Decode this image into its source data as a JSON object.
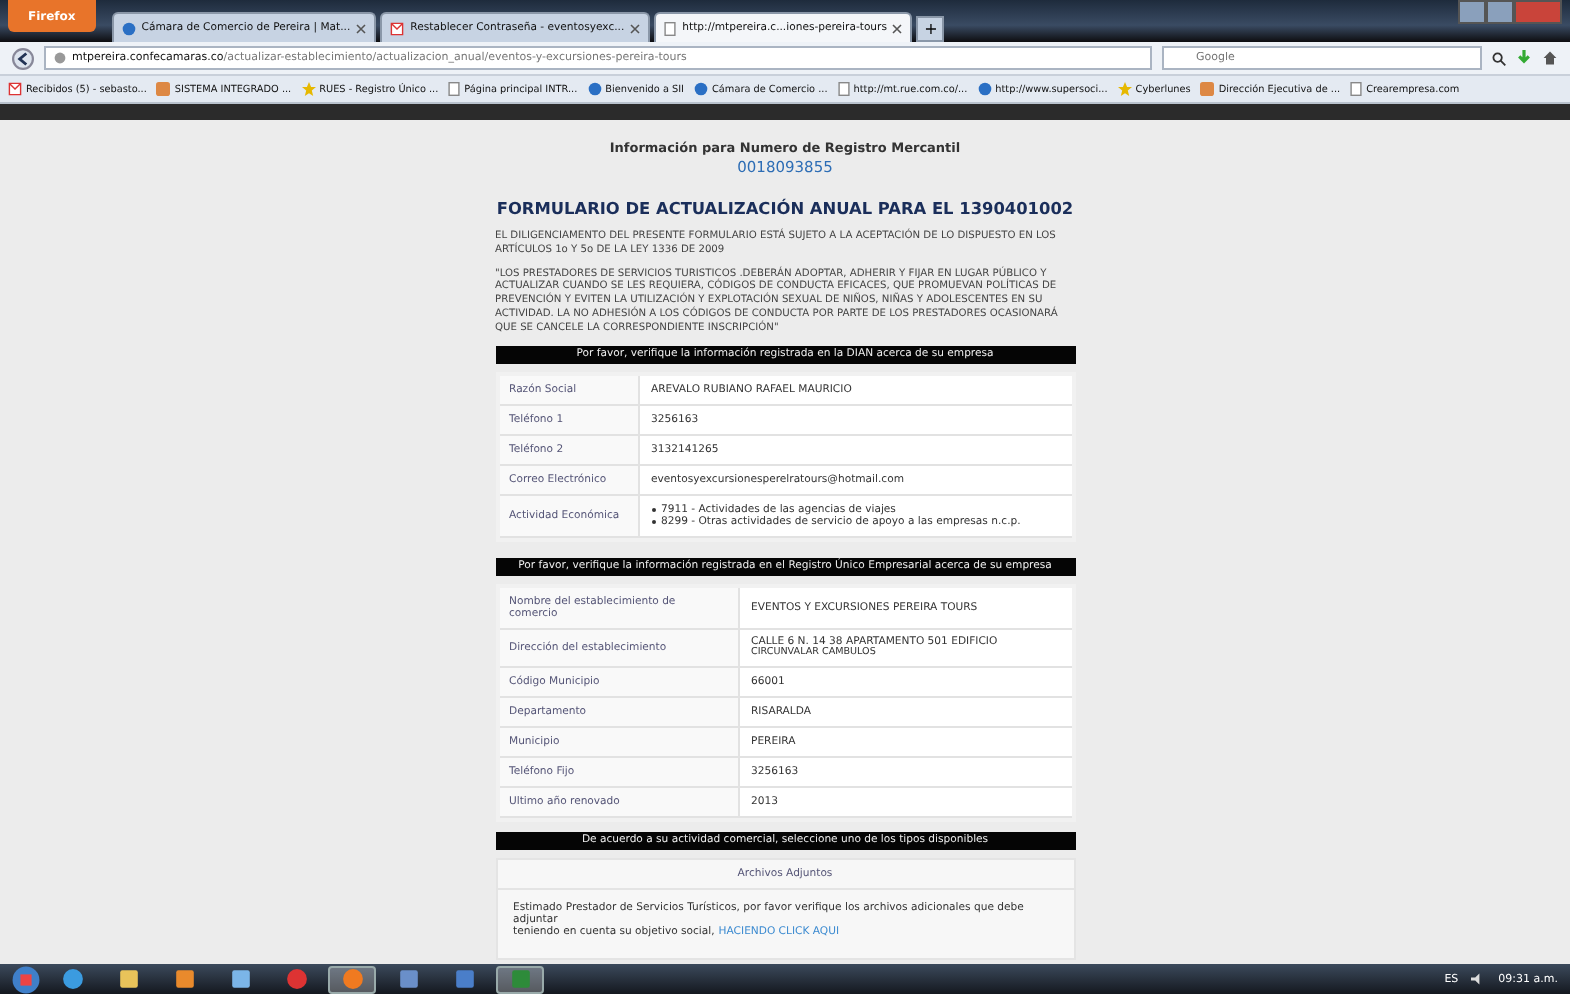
{
  "browser": {
    "menu_button": "Firefox",
    "tabs": [
      {
        "label": "Cámara de Comercio de Pereira | Mat...",
        "selected": false
      },
      {
        "label": "Restablecer Contraseña - eventosyexc...",
        "selected": false
      },
      {
        "label": "http://mtpereira.c...iones-pereira-tours",
        "selected": true
      }
    ],
    "new_tab": "+",
    "address": {
      "domain": "mtpereira.confecamaras.co",
      "path": "/actualizar-establecimiento/actualizacion_anual/eventos-y-excursiones-pereira-tours"
    },
    "search": {
      "placeholder": "Google"
    },
    "bookmarks": [
      "Recibidos (5) - sebasto...",
      "SISTEMA INTEGRADO ...",
      "RUES - Registro Único ...",
      "Página principal INTR...",
      "Bienvenido a SII",
      "Cámara de Comercio ...",
      "http://mt.rue.com.co/...",
      "http://www.supersoci...",
      "Cyberlunes",
      "Dirección Ejecutiva de ...",
      "Crearempresa.com"
    ]
  },
  "page": {
    "header": "Información para Numero de Registro Mercantil",
    "registry_number": "0018093855",
    "title": "FORMULARIO DE ACTUALIZACIÓN ANUAL PARA EL 1390401002",
    "notice": "EL DILIGENCIAMENTO DEL PRESENTE FORMULARIO ESTÁ SUJETO A LA ACEPTACIÓN DE LO DISPUESTO EN LOS ARTÍCULOS 1o Y 5o DE LA LEY 1336 DE 2009",
    "quote": "\"LOS PRESTADORES DE SERVICIOS TURISTICOS .DEBERÁN ADOPTAR, ADHERIR Y FIJAR EN LUGAR PÚBLICO Y ACTUALIZAR CUANDO SE LES REQUIERA, CÓDIGOS DE CONDUCTA EFICACES, QUE PROMUEVAN POLÍTICAS DE PREVENCIÓN Y EVITEN LA UTILIZACIÓN Y EXPLOTACIÓN SEXUAL DE NIÑOS, NIÑAS Y ADOLESCENTES EN SU ACTIVIDAD. LA NO ADHESIÓN A LOS CÓDIGOS DE CONDUCTA POR PARTE DE LOS PRESTADORES OCASIONARÁ QUE SE CANCELE LA CORRESPONDIENTE INSCRIPCIÓN\"",
    "dian_bar": "Por favor, verifique la información registrada en la DIAN acerca de su empresa",
    "dian_rows": [
      {
        "label": "Razón Social",
        "value": "AREVALO RUBIANO RAFAEL MAURICIO"
      },
      {
        "label": "Teléfono 1",
        "value": "3256163"
      },
      {
        "label": "Teléfono 2",
        "value": "3132141265"
      },
      {
        "label": "Correo Electrónico",
        "value": "eventosyexcursionesperelratours@hotmail.com"
      },
      {
        "label": "Actividad Económica",
        "items": [
          "7911 - Actividades de las agencias de viajes",
          "8299 - Otras actividades de servicio de apoyo a las empresas n.c.p."
        ]
      }
    ],
    "rue_bar": "Por favor, verifique la información registrada en el Registro Único Empresarial acerca de su empresa",
    "rue_rows": [
      {
        "label": "Nombre del establecimiento de comercio",
        "value": "EVENTOS Y EXCURSIONES PEREIRA TOURS"
      },
      {
        "label": "Dirección del establecimiento",
        "value": "CALLE 6 N. 14 38 APARTAMENTO 501 EDIFICIO",
        "value_2": "CIRCUNVALAR CAMBULOS"
      },
      {
        "label": "Código Municipio",
        "value": "66001"
      },
      {
        "label": "Departamento",
        "value": "RISARALDA"
      },
      {
        "label": "Municipio",
        "value": "PEREIRA"
      },
      {
        "label": "Teléfono Fijo",
        "value": "3256163"
      },
      {
        "label": "Ultimo año renovado",
        "value": "2013"
      }
    ],
    "activity_bar": "De acuerdo a su actividad comercial, seleccione uno de los tipos disponibles",
    "attachments": {
      "heading": "Archivos Adjuntos",
      "text": "Estimado Prestador de Servicios Turísticos, por favor verifique los archivos adicionales que debe adjuntar",
      "text_2": "teniendo en cuenta su objetivo social,",
      "link": "HACIENDO CLICK AQUI"
    }
  },
  "taskbar": {
    "apps": [
      {
        "active": false
      },
      {
        "active": false
      },
      {
        "active": false
      },
      {
        "active": false
      },
      {
        "active": false
      },
      {
        "active": true
      },
      {
        "active": false
      },
      {
        "active": false
      },
      {
        "active": true
      }
    ],
    "language": "ES",
    "time": "09:31 a.m."
  }
}
